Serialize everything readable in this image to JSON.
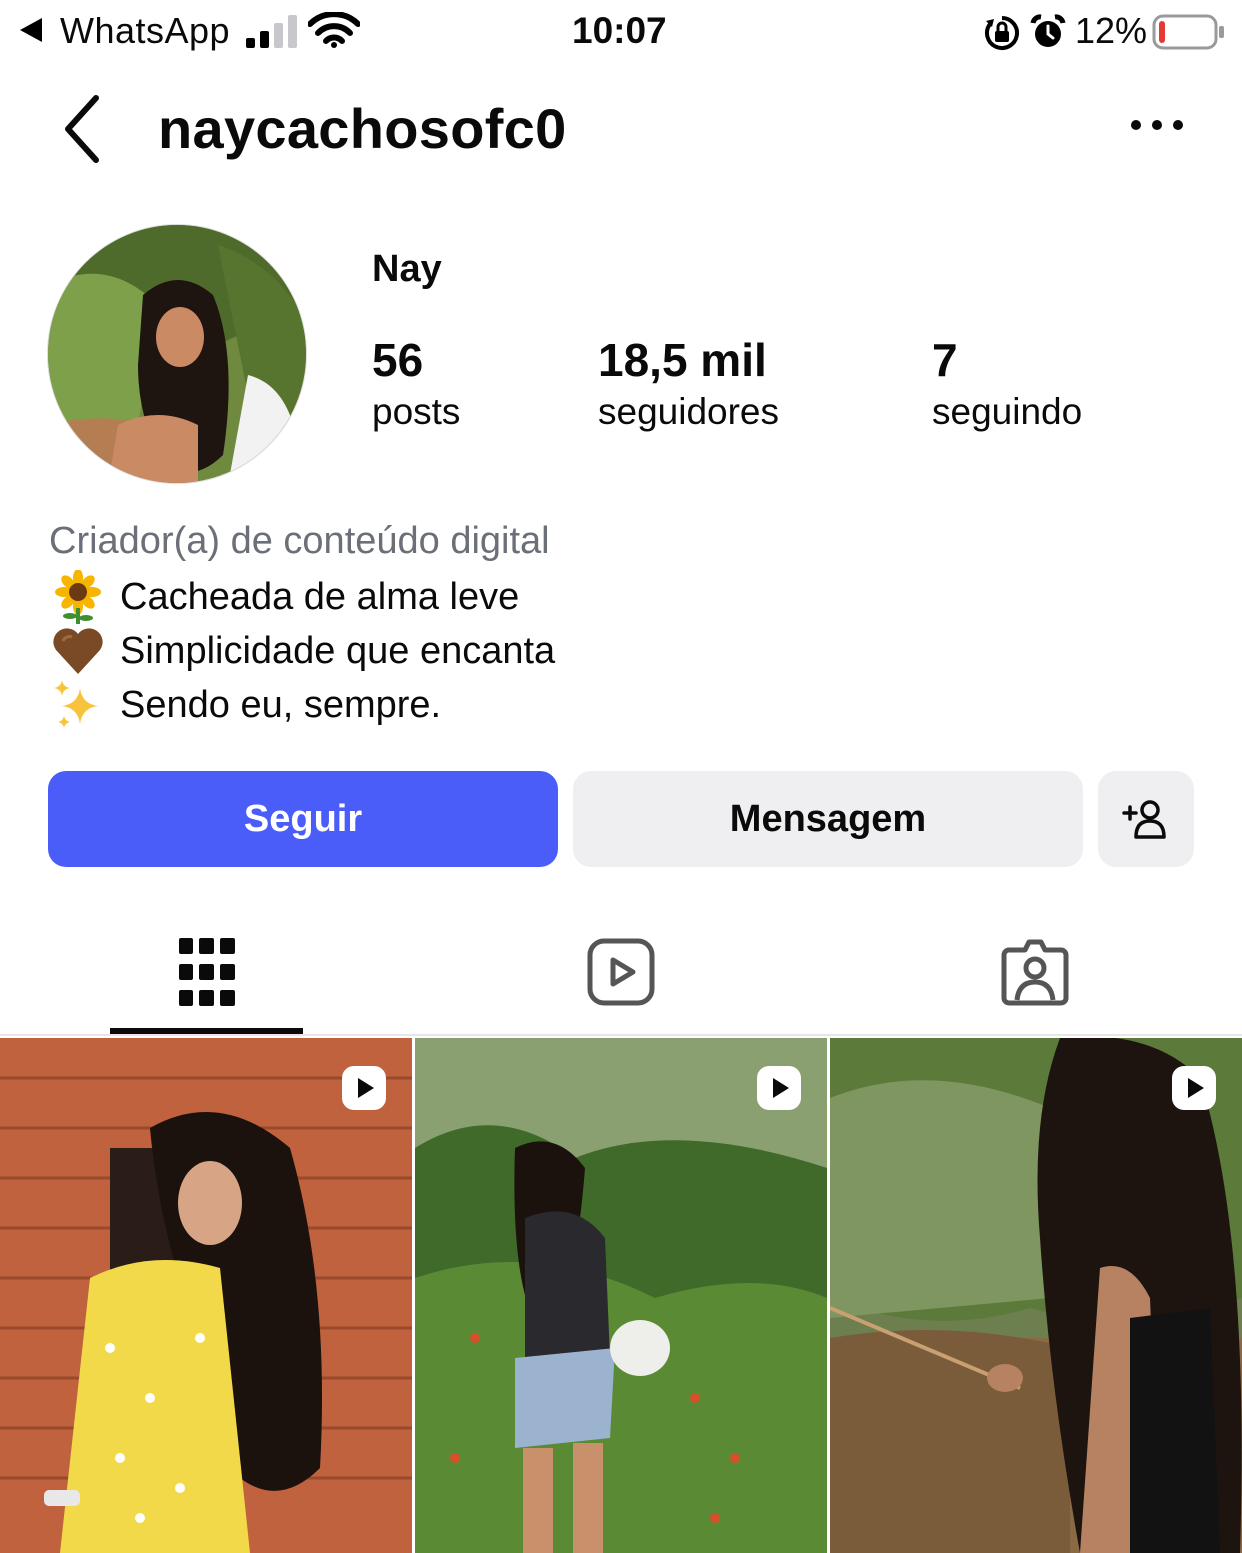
{
  "status_bar": {
    "back_app": "WhatsApp",
    "time": "10:07",
    "battery_percent": "12%",
    "battery_level": 0.12,
    "signal_bars": 2
  },
  "header": {
    "username": "naycachosofc0"
  },
  "profile": {
    "display_name": "Nay",
    "stats": {
      "posts_count": "56",
      "posts_label": "posts",
      "followers_count": "18,5 mil",
      "followers_label": "seguidores",
      "following_count": "7",
      "following_label": "seguindo"
    },
    "bio": {
      "category": "Criador(a) de conteúdo digital",
      "lines": [
        {
          "emoji": "sunflower-emoji",
          "text": "Cacheada de alma leve"
        },
        {
          "emoji": "brown-heart-emoji",
          "text": "Simplicidade que encanta"
        },
        {
          "emoji": "sparkles-emoji",
          "text": "Sendo eu, sempre."
        }
      ]
    }
  },
  "actions": {
    "follow_label": "Seguir",
    "message_label": "Mensagem"
  },
  "tabs": [
    {
      "icon": "grid-icon",
      "active": true
    },
    {
      "icon": "reels-icon",
      "active": false
    },
    {
      "icon": "tagged-icon",
      "active": false
    }
  ],
  "colors": {
    "accent": "#4a5df9",
    "secondary_button": "#efeff1",
    "category_text": "#6b6f78"
  }
}
